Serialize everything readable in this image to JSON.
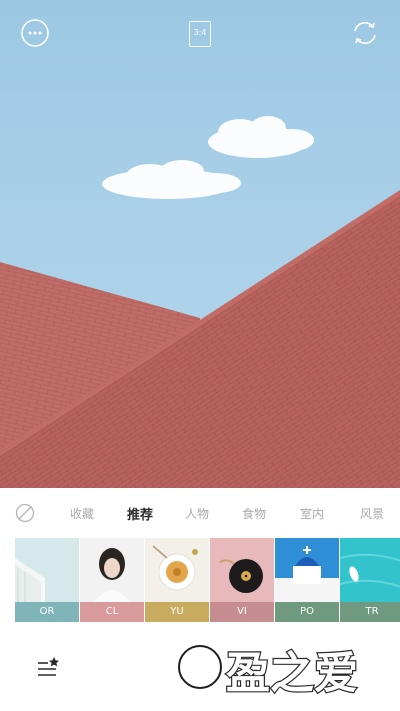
{
  "topbar": {
    "more_icon": "more-dots-icon",
    "ratio_label": "3:4",
    "switch_icon": "camera-switch-icon"
  },
  "tabs": {
    "none_icon": "no-filter-icon",
    "items": [
      "收藏",
      "推荐",
      "人物",
      "食物",
      "室内",
      "风景"
    ],
    "active": "推荐"
  },
  "filters": [
    {
      "code": "OR",
      "color": "#7fb4b9"
    },
    {
      "code": "CL",
      "color": "#d99a9c"
    },
    {
      "code": "YU",
      "color": "#c9ab60"
    },
    {
      "code": "VI",
      "color": "#c58d90"
    },
    {
      "code": "PO",
      "color": "#6f9a80"
    },
    {
      "code": "TR",
      "color": "#6f9a80"
    }
  ],
  "bottombar": {
    "favorites_icon": "filter-favorites-icon",
    "shutter": "shutter-button",
    "watermark_text": "盈之爱"
  }
}
